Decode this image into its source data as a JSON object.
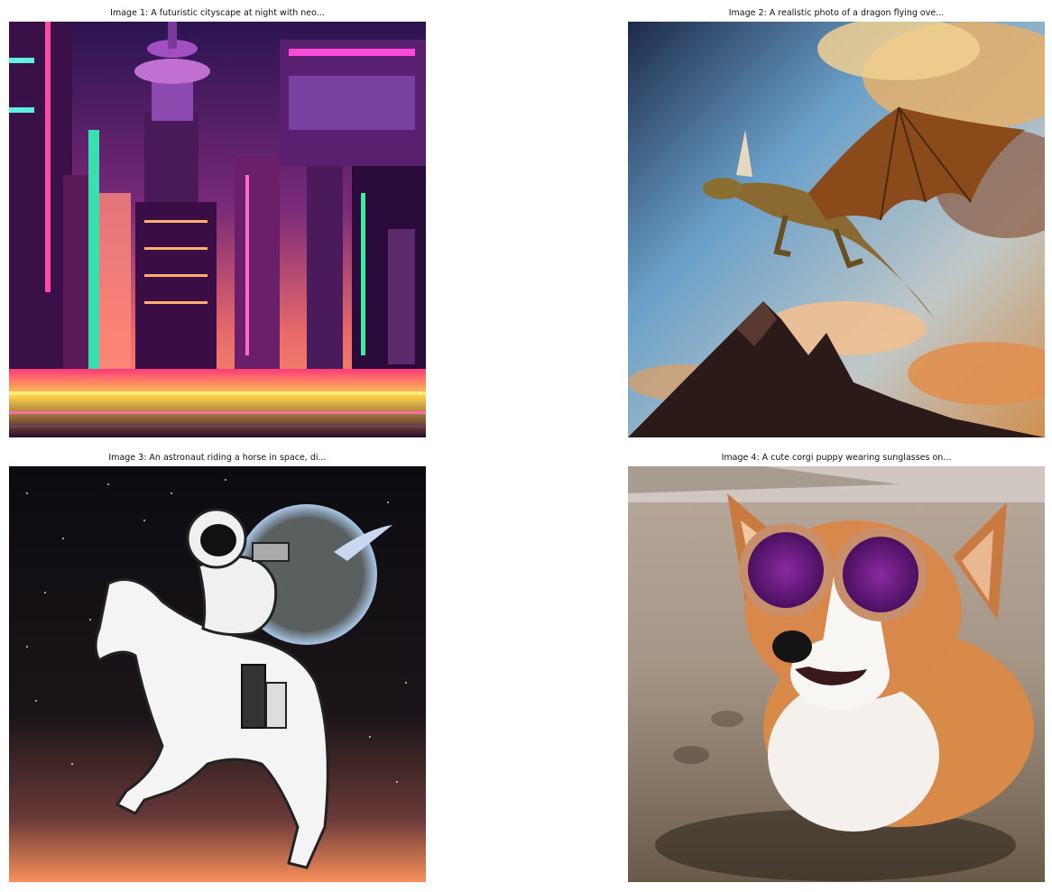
{
  "images": [
    {
      "caption": "Image 1: A futuristic cityscape at night with neo...",
      "subject": "neon-cityscape"
    },
    {
      "caption": "Image 2: A realistic photo of a dragon flying ove...",
      "subject": "dragon-over-mountains"
    },
    {
      "caption": "Image 3: An astronaut riding a horse in space, di...",
      "subject": "astronaut-on-horse"
    },
    {
      "caption": "Image 4: A cute corgi puppy wearing sunglasses on...",
      "subject": "corgi-with-sunglasses"
    }
  ],
  "colors": {
    "background": "#ffffff",
    "caption_text": "#111111"
  }
}
